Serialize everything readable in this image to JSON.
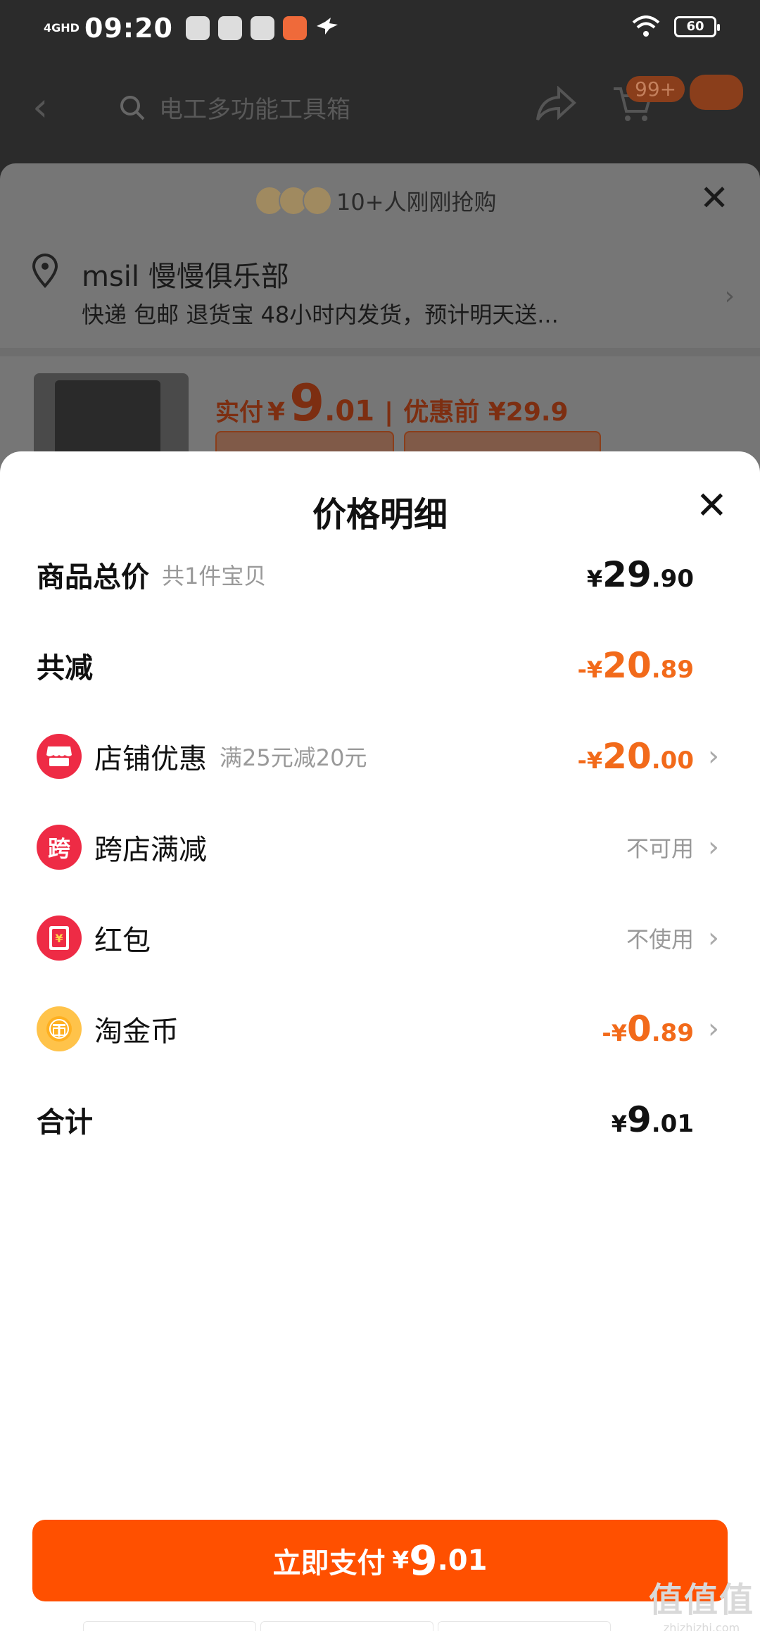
{
  "status_bar": {
    "network": "4GHD",
    "time": "09:20",
    "battery": "60"
  },
  "top_nav": {
    "search_placeholder": "电工多功能工具箱",
    "cart_badge": "99+"
  },
  "sku_sheet": {
    "buyers_text": "10+人刚刚抢购",
    "address_name": "msil 慢慢俱乐部",
    "address_sub": "快递 包邮 退货宝 48小时内发货，预计明天送...",
    "price_label": "实付",
    "price_yen": "¥",
    "price_int": "9",
    "price_dec": ".01",
    "price_before_label": "优惠前 ¥29.9"
  },
  "sheet": {
    "title": "价格明细",
    "total": {
      "label": "商品总价",
      "sub": "共1件宝贝",
      "yen": "¥",
      "int": "29",
      "dec": ".90"
    },
    "discount": {
      "label": "共减",
      "yen": "-¥",
      "int": "20",
      "dec": ".89"
    },
    "items": [
      {
        "label": "店铺优惠",
        "sub": "满25元减20元",
        "yen": "-¥",
        "int": "20",
        "dec": ".00"
      },
      {
        "label": "跨店满减",
        "icon_text": "跨",
        "status": "不可用"
      },
      {
        "label": "红包",
        "status": "不使用"
      },
      {
        "label": "淘金币",
        "yen": "-¥",
        "int": "0",
        "dec": ".89"
      }
    ],
    "sum": {
      "label": "合计",
      "yen": "¥",
      "int": "9",
      "dec": ".01"
    }
  },
  "pay_button": {
    "label": "立即支付",
    "yen": "¥",
    "int": "9",
    "dec": ".01"
  },
  "watermark": {
    "top": "值值值",
    "bottom": "zhizhizhi.com"
  },
  "colors": {
    "accent": "#ff5000",
    "discount": "#f26a1a",
    "icon_red": "#ee2b45",
    "coin": "#ffc34a"
  }
}
